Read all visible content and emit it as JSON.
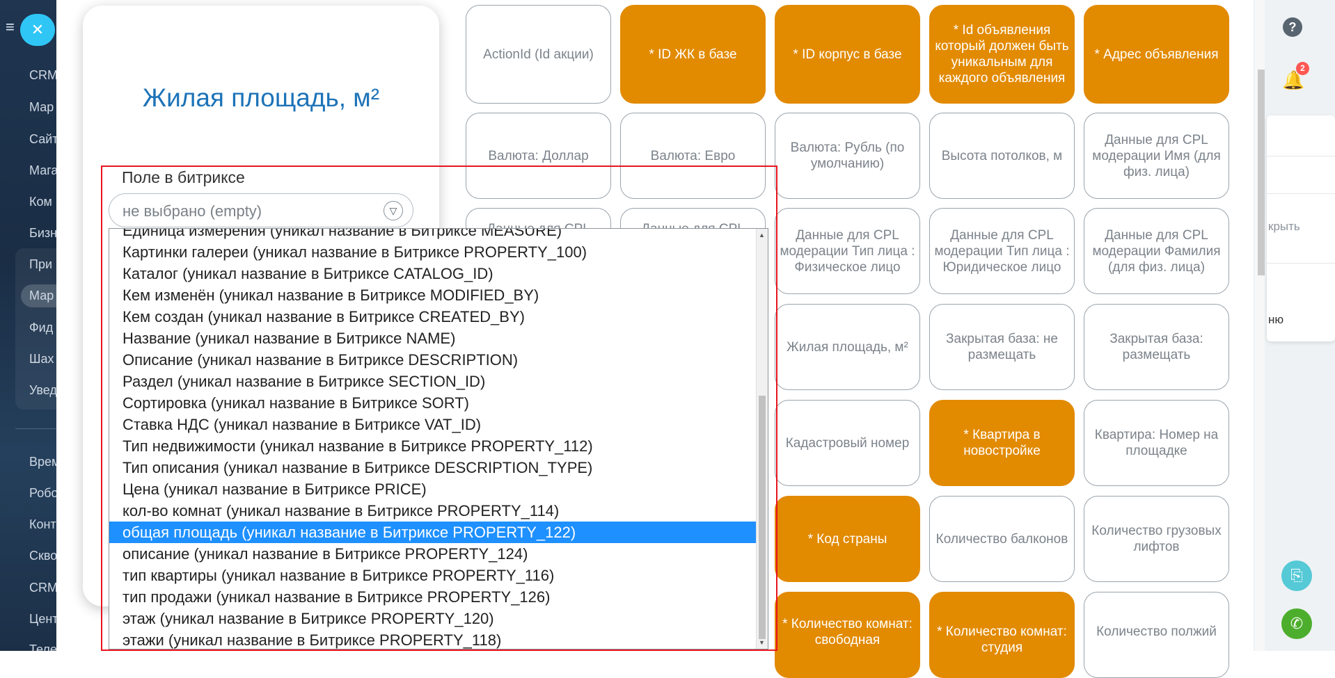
{
  "sidebar": {
    "items": [
      "CRM",
      "Мар",
      "Сайт",
      "Мага",
      "Ком",
      "Бизн",
      "При",
      "Мар",
      "Фид",
      "Шах",
      "Увед",
      "Врем",
      "Робо",
      "Конт",
      "Скво",
      "CRM",
      "Цент",
      "Теле"
    ]
  },
  "editor": {
    "title": "Жилая площадь, м²",
    "field_label": "Поле в битриксе",
    "select_value": "не выбрано (empty)"
  },
  "dropdown": {
    "options": [
      "Единица измерения (уникал название в Битриксе MEASURE)",
      "Картинки галереи (уникал название в Битриксе PROPERTY_100)",
      "Каталог (уникал название в Битриксе CATALOG_ID)",
      "Кем изменён (уникал название в Битриксе MODIFIED_BY)",
      "Кем создан (уникал название в Битриксе CREATED_BY)",
      "Название (уникал название в Битриксе NAME)",
      "Описание (уникал название в Битриксе DESCRIPTION)",
      "Раздел (уникал название в Битриксе SECTION_ID)",
      "Сортировка (уникал название в Битриксе SORT)",
      "Ставка НДС (уникал название в Битриксе VAT_ID)",
      "Тип недвижимости (уникал название в Битриксе PROPERTY_112)",
      "Тип описания (уникал название в Битриксе DESCRIPTION_TYPE)",
      "Цена (уникал название в Битриксе PRICE)",
      "кол-во комнат (уникал название в Битриксе PROPERTY_114)",
      "общая площадь (уникал название в Битриксе PROPERTY_122)",
      "описание (уникал название в Битриксе PROPERTY_124)",
      "тип квартиры (уникал название в Битриксе PROPERTY_116)",
      "тип продажи (уникал название в Битриксе PROPERTY_126)",
      "этаж (уникал название в Битриксе PROPERTY_120)",
      "этажи (уникал название в Битриксе PROPERTY_118)"
    ],
    "selected": "общая площадь (уникал название в Битриксе PROPERTY_122)"
  },
  "tiles": [
    {
      "label": "ActionId (Id акции)",
      "required": false
    },
    {
      "label": "* ID ЖК в базе",
      "required": true
    },
    {
      "label": "* ID корпус в базе",
      "required": true
    },
    {
      "label": "* Id объявления который должен быть уникальным для каждого объявления",
      "required": true
    },
    {
      "label": "* Адрес объявления",
      "required": true
    },
    {
      "label": "Валюта: Доллар",
      "required": false
    },
    {
      "label": "Валюта: Евро",
      "required": false
    },
    {
      "label": "Валюта: Рубль (по умолчанию)",
      "required": false
    },
    {
      "label": "Высота потолков, м",
      "required": false
    },
    {
      "label": "Данные для CPL модерации Имя (для физ. лица)",
      "required": false
    },
    {
      "label": "Данные для CPL",
      "required": false
    },
    {
      "label": "Данные для CPL",
      "required": false
    },
    {
      "label": "Данные для CPL модерации Тип лица : Физическое лицо",
      "required": false
    },
    {
      "label": "Данные для CPL модерации Тип лица : Юридическое лицо",
      "required": false
    },
    {
      "label": "Данные для CPL модерации Фамилия (для физ. лица)",
      "required": false
    },
    {
      "label": "Жилая площадь, м²",
      "required": false
    },
    {
      "label": "Закрытая база: не размещать",
      "required": false
    },
    {
      "label": "Закрытая база: размещать",
      "required": false
    },
    {
      "label": "Кадастровый номер",
      "required": false
    },
    {
      "label": "* Квартира в новостройке",
      "required": true
    },
    {
      "label": "Квартира: Номер на площадке",
      "required": false
    },
    {
      "label": "* Код страны",
      "required": true
    },
    {
      "label": "Количество балконов",
      "required": false
    },
    {
      "label": "Количество грузовых лифтов",
      "required": false
    },
    {
      "label": "* Количество комнат: свободная",
      "required": true
    },
    {
      "label": "* Количество комнат: студия",
      "required": true
    },
    {
      "label": "Количество полжий",
      "required": false
    }
  ],
  "right_panel": {
    "help_label": "?",
    "notifications_count": "2",
    "card_text_1": "крыть",
    "card_text_2": "ню"
  },
  "colors": {
    "accent_required": "#e28a00",
    "title_blue": "#1d73b8",
    "selection": "#1e90ff",
    "annotation_red": "#e8141d",
    "sidebar_close": "#2fc6f6"
  }
}
